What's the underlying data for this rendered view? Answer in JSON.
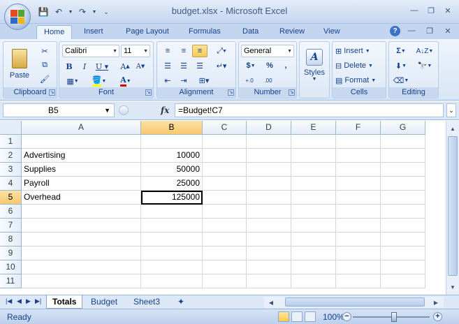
{
  "window": {
    "title": "budget.xlsx - Microsoft Excel",
    "minimize": "—",
    "maximize": "❐",
    "close": "✕"
  },
  "ribbon_tabs": [
    "Home",
    "Insert",
    "Page Layout",
    "Formulas",
    "Data",
    "Review",
    "View"
  ],
  "ribbon": {
    "clipboard": {
      "label": "Clipboard",
      "paste": "Paste"
    },
    "font": {
      "label": "Font",
      "family": "Calibri",
      "size": "11"
    },
    "alignment": {
      "label": "Alignment"
    },
    "number": {
      "label": "Number",
      "format": "General",
      "currency": "$",
      "percent": "%",
      "comma": ","
    },
    "styles": {
      "label": "Styles"
    },
    "cells": {
      "label": "Cells",
      "insert": "Insert",
      "delete": "Delete",
      "format": "Format"
    },
    "editing": {
      "label": "Editing"
    }
  },
  "formula_bar": {
    "name_box": "B5",
    "fx": "fx",
    "formula": "=Budget!C7"
  },
  "grid": {
    "columns": [
      "A",
      "B",
      "C",
      "D",
      "E",
      "F",
      "G"
    ],
    "rows": [
      "1",
      "2",
      "3",
      "4",
      "5",
      "6",
      "7",
      "8",
      "9",
      "10",
      "11"
    ],
    "active_column": "B",
    "active_row": "5",
    "cells": {
      "A2": "Advertising",
      "B2": "10000",
      "A3": "Supplies",
      "B3": "50000",
      "A4": "Payroll",
      "B4": "25000",
      "A5": "Overhead",
      "B5": "125000"
    }
  },
  "sheets": [
    "Totals",
    "Budget",
    "Sheet3"
  ],
  "active_sheet": "Totals",
  "status": {
    "mode": "Ready",
    "zoom": "100%"
  },
  "colors": {
    "accent": "#15428b",
    "ribbon_bg": "#dde8f6",
    "selected_header": "#f8c86e"
  }
}
